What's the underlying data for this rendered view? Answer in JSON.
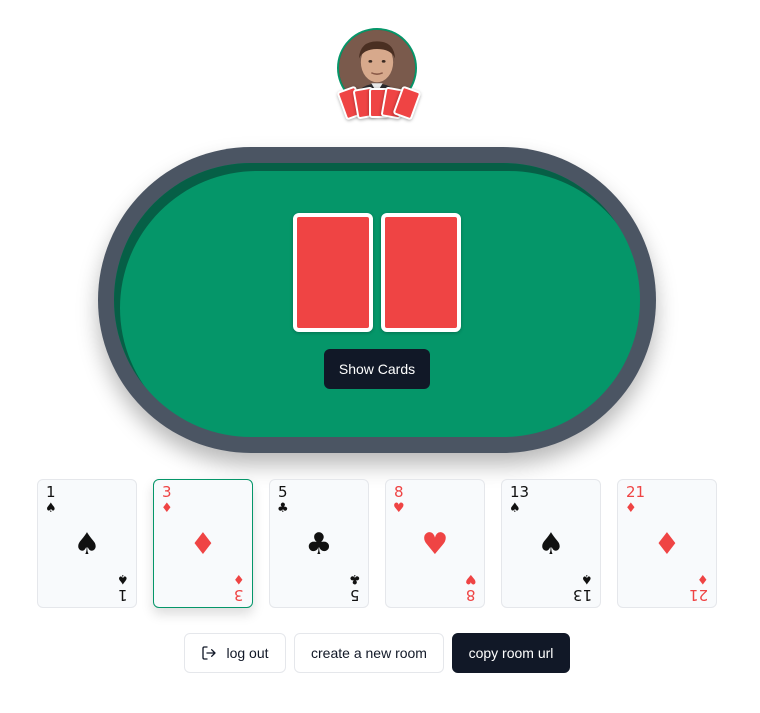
{
  "opponent": {
    "avatar_icon": "player-portrait",
    "hand_count": 5,
    "card_back_color": "#ef4444"
  },
  "table": {
    "rail_color": "#4b5563",
    "felt_color": "#059669",
    "face_down_cards": 2,
    "show_cards_label": "Show Cards"
  },
  "hand": {
    "cards": [
      {
        "rank": "1",
        "suit": "♠",
        "color": "black",
        "selected": false
      },
      {
        "rank": "3",
        "suit": "♦",
        "color": "red",
        "selected": true
      },
      {
        "rank": "5",
        "suit": "♣",
        "color": "black",
        "selected": false
      },
      {
        "rank": "8",
        "suit": "♥",
        "color": "red",
        "selected": false
      },
      {
        "rank": "13",
        "suit": "♠",
        "color": "black",
        "selected": false
      },
      {
        "rank": "21",
        "suit": "♦",
        "color": "red",
        "selected": false
      }
    ]
  },
  "actions": {
    "logout_label": "log out",
    "logout_icon": "logout-icon",
    "new_room_label": "create a new room",
    "copy_url_label": "copy room url"
  }
}
